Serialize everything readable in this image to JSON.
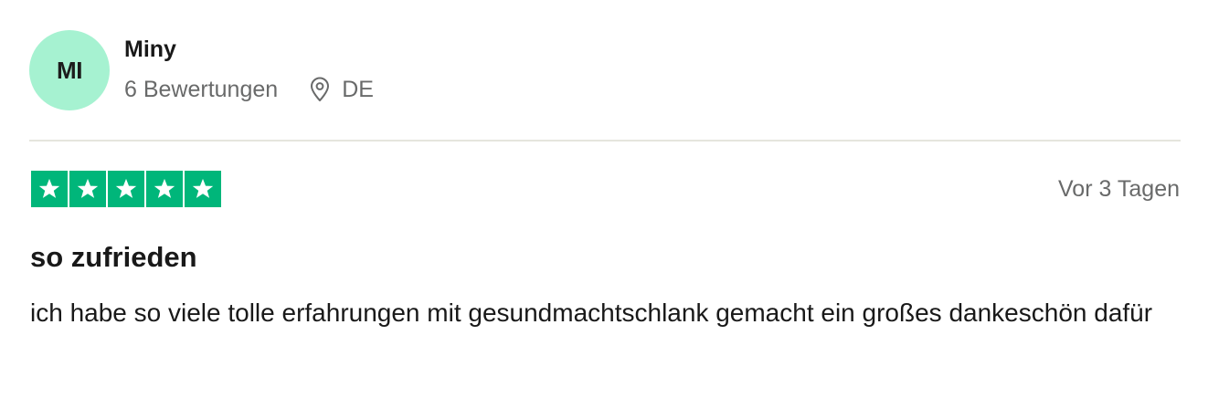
{
  "reviewer": {
    "initials": "MI",
    "name": "Miny",
    "review_count": "6 Bewertungen",
    "country": "DE",
    "avatar_color": "#a6f2d1"
  },
  "review": {
    "rating": 5,
    "date": "Vor 3 Tagen",
    "title": "so zufrieden",
    "text": "ich habe so viele tolle erfahrungen mit gesundmachtschlank gemacht ein großes dankeschön dafür"
  },
  "icons": {
    "location": "location-pin-icon",
    "star": "star-icon"
  },
  "colors": {
    "star_green": "#00b67a",
    "muted_text": "#696a6a",
    "divider": "#e5e5dd"
  }
}
